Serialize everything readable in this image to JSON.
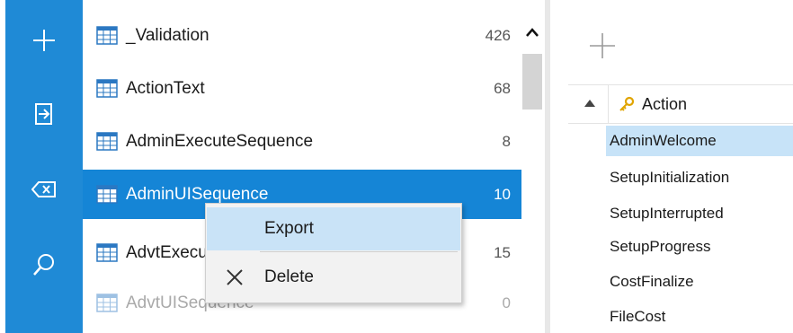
{
  "rail": {
    "items": [
      {
        "icon": "plus-icon"
      },
      {
        "icon": "import-icon"
      },
      {
        "icon": "backspace-icon"
      },
      {
        "icon": "search-icon"
      }
    ]
  },
  "tables": [
    {
      "name": "_Validation",
      "count": "426"
    },
    {
      "name": "ActionText",
      "count": "68"
    },
    {
      "name": "AdminExecuteSequence",
      "count": "8"
    },
    {
      "name": "AdminUISequence",
      "count": "10"
    },
    {
      "name": "AdvtExecuteSequence",
      "count": "15"
    },
    {
      "name": "AdvtUISequence",
      "count": "0"
    }
  ],
  "context_menu": {
    "export_label": "Export",
    "delete_label": "Delete"
  },
  "right_panel": {
    "column_header": "Action",
    "rows": [
      "AdminWelcome",
      "SetupInitialization",
      "SetupInterrupted",
      "SetupProgress",
      "CostFinalize",
      "FileCost"
    ]
  },
  "colors": {
    "rail": "#1f8ad6",
    "selection": "#1585d6",
    "highlight": "#c9e3f7"
  }
}
